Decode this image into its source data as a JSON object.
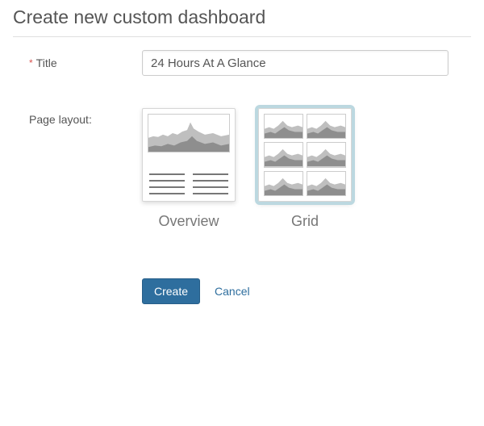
{
  "heading": "Create new custom dashboard",
  "form": {
    "title_label": "Title",
    "title_value": "24 Hours At A Glance",
    "required_marker": "*"
  },
  "layout": {
    "label": "Page layout:",
    "options": [
      {
        "id": "overview",
        "caption": "Overview",
        "selected": false
      },
      {
        "id": "grid",
        "caption": "Grid",
        "selected": true
      }
    ]
  },
  "actions": {
    "create": "Create",
    "cancel": "Cancel"
  },
  "colors": {
    "accent": "#2e6e9e",
    "selected_outline": "#bcd8e0"
  }
}
